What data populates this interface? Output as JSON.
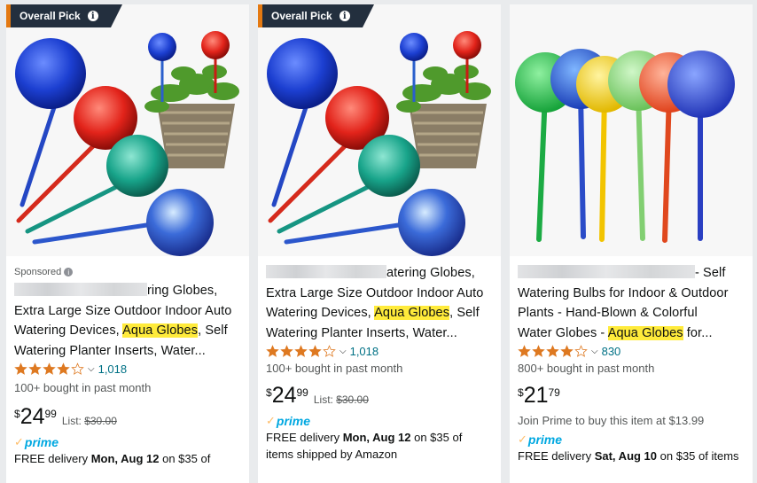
{
  "cards": [
    {
      "badge": "Overall Pick",
      "sponsored": "Sponsored",
      "title_line1_tail": "ring Globes,",
      "title_line2": "Extra Large Size Outdoor Indoor Auto",
      "title_line3_pre": "Watering Devices, ",
      "highlight": "Aqua Globes",
      "title_line3_post": ", Self",
      "title_line4": "Watering Planter Inserts, Water...",
      "rating": 4.0,
      "review_count": "1,018",
      "bought": "100+ bought in past month",
      "price_symbol": "$",
      "price_whole": "24",
      "price_fraction": "99",
      "list_label": "List: ",
      "list_price": "$30.00",
      "prime_label": "prime",
      "delivery_pre": "FREE delivery ",
      "delivery_date": "Mon, Aug 12",
      "delivery_post": " on $35 of"
    },
    {
      "badge": "Overall Pick",
      "title_line1_tail": "atering Globes,",
      "title_line2": "Extra Large Size Outdoor Indoor Auto",
      "title_line3_pre": "Watering Devices, ",
      "highlight": "Aqua Globes",
      "title_line3_post": ", Self",
      "title_line4": "Watering Planter Inserts, Water...",
      "rating": 4.0,
      "review_count": "1,018",
      "bought": "100+ bought in past month",
      "price_symbol": "$",
      "price_whole": "24",
      "price_fraction": "99",
      "list_label": "List: ",
      "list_price": "$30.00",
      "prime_label": "prime",
      "delivery_pre": "FREE delivery ",
      "delivery_date": "Mon, Aug 12",
      "delivery_post": " on $35 of",
      "delivery_line2": "items shipped by Amazon"
    },
    {
      "title_line1_tail": "- Self",
      "title_line2": "Watering Bulbs for Indoor & Outdoor",
      "title_line3": "Plants - Hand-Blown & Colorful",
      "title_line4_pre": "Water Globes - ",
      "highlight": "Aqua Globes",
      "title_line4_post": " for...",
      "rating": 4.0,
      "review_count": "830",
      "bought": "800+ bought in past month",
      "price_symbol": "$",
      "price_whole": "21",
      "price_fraction": "79",
      "join_prime": "Join Prime to buy this item at $13.99",
      "prime_label": "prime",
      "delivery_pre": "FREE delivery ",
      "delivery_date": "Sat, Aug 10",
      "delivery_post": " on $35 of items"
    }
  ],
  "colors": {
    "badge_bg": "#232f3e",
    "badge_accent": "#e47911",
    "star": "#de7921",
    "link": "#007185",
    "prime": "#00a8e1",
    "highlight": "#ffeb3b"
  }
}
